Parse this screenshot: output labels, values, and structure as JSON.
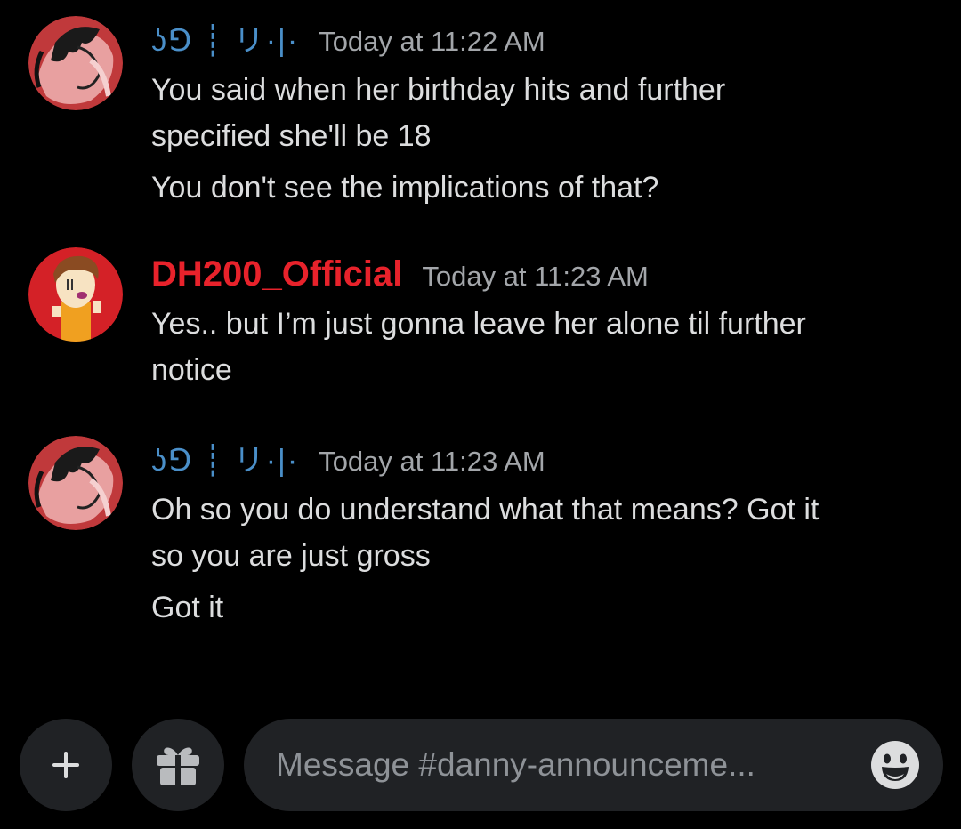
{
  "messages": [
    {
      "username": "ʖꓨ ┊ リ·|·",
      "timestamp": "Today at 11:22 AM",
      "lines": [
        "You said when her birthday hits and further",
        "specified she'll be 18",
        "You don't see the implications of that?"
      ]
    },
    {
      "username": "DH200_Official",
      "timestamp": "Today at 11:23 AM",
      "lines": [
        "Yes.. but I’m just gonna leave her alone til further",
        "notice"
      ]
    },
    {
      "username": "ʖꓨ ┊ リ·|·",
      "timestamp": "Today at 11:23 AM",
      "lines": [
        "Oh so you do understand what that means? Got it",
        "so you are just gross",
        "Got it"
      ]
    }
  ],
  "composer": {
    "placeholder": "Message #danny-announceme...",
    "value": "",
    "plus_icon": "plus-icon",
    "gift_icon": "gift-icon",
    "emoji_icon": "emoji-smile-icon"
  },
  "colors": {
    "background": "#000000",
    "username_muted": "#4a8fc9",
    "username_red": "#e8222b",
    "timestamp": "#a3a6aa",
    "message_text": "#dcddde",
    "composer_bg": "#202225"
  }
}
